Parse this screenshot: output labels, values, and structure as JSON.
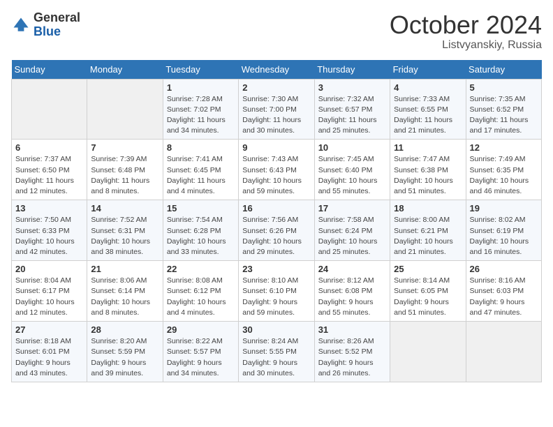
{
  "header": {
    "logo_general": "General",
    "logo_blue": "Blue",
    "month_title": "October 2024",
    "location": "Listvyanskiy, Russia"
  },
  "days_of_week": [
    "Sunday",
    "Monday",
    "Tuesday",
    "Wednesday",
    "Thursday",
    "Friday",
    "Saturday"
  ],
  "weeks": [
    [
      {
        "day": "",
        "empty": true
      },
      {
        "day": "",
        "empty": true
      },
      {
        "day": "1",
        "sunrise": "Sunrise: 7:28 AM",
        "sunset": "Sunset: 7:02 PM",
        "daylight": "Daylight: 11 hours and 34 minutes."
      },
      {
        "day": "2",
        "sunrise": "Sunrise: 7:30 AM",
        "sunset": "Sunset: 7:00 PM",
        "daylight": "Daylight: 11 hours and 30 minutes."
      },
      {
        "day": "3",
        "sunrise": "Sunrise: 7:32 AM",
        "sunset": "Sunset: 6:57 PM",
        "daylight": "Daylight: 11 hours and 25 minutes."
      },
      {
        "day": "4",
        "sunrise": "Sunrise: 7:33 AM",
        "sunset": "Sunset: 6:55 PM",
        "daylight": "Daylight: 11 hours and 21 minutes."
      },
      {
        "day": "5",
        "sunrise": "Sunrise: 7:35 AM",
        "sunset": "Sunset: 6:52 PM",
        "daylight": "Daylight: 11 hours and 17 minutes."
      }
    ],
    [
      {
        "day": "6",
        "sunrise": "Sunrise: 7:37 AM",
        "sunset": "Sunset: 6:50 PM",
        "daylight": "Daylight: 11 hours and 12 minutes."
      },
      {
        "day": "7",
        "sunrise": "Sunrise: 7:39 AM",
        "sunset": "Sunset: 6:48 PM",
        "daylight": "Daylight: 11 hours and 8 minutes."
      },
      {
        "day": "8",
        "sunrise": "Sunrise: 7:41 AM",
        "sunset": "Sunset: 6:45 PM",
        "daylight": "Daylight: 11 hours and 4 minutes."
      },
      {
        "day": "9",
        "sunrise": "Sunrise: 7:43 AM",
        "sunset": "Sunset: 6:43 PM",
        "daylight": "Daylight: 10 hours and 59 minutes."
      },
      {
        "day": "10",
        "sunrise": "Sunrise: 7:45 AM",
        "sunset": "Sunset: 6:40 PM",
        "daylight": "Daylight: 10 hours and 55 minutes."
      },
      {
        "day": "11",
        "sunrise": "Sunrise: 7:47 AM",
        "sunset": "Sunset: 6:38 PM",
        "daylight": "Daylight: 10 hours and 51 minutes."
      },
      {
        "day": "12",
        "sunrise": "Sunrise: 7:49 AM",
        "sunset": "Sunset: 6:35 PM",
        "daylight": "Daylight: 10 hours and 46 minutes."
      }
    ],
    [
      {
        "day": "13",
        "sunrise": "Sunrise: 7:50 AM",
        "sunset": "Sunset: 6:33 PM",
        "daylight": "Daylight: 10 hours and 42 minutes."
      },
      {
        "day": "14",
        "sunrise": "Sunrise: 7:52 AM",
        "sunset": "Sunset: 6:31 PM",
        "daylight": "Daylight: 10 hours and 38 minutes."
      },
      {
        "day": "15",
        "sunrise": "Sunrise: 7:54 AM",
        "sunset": "Sunset: 6:28 PM",
        "daylight": "Daylight: 10 hours and 33 minutes."
      },
      {
        "day": "16",
        "sunrise": "Sunrise: 7:56 AM",
        "sunset": "Sunset: 6:26 PM",
        "daylight": "Daylight: 10 hours and 29 minutes."
      },
      {
        "day": "17",
        "sunrise": "Sunrise: 7:58 AM",
        "sunset": "Sunset: 6:24 PM",
        "daylight": "Daylight: 10 hours and 25 minutes."
      },
      {
        "day": "18",
        "sunrise": "Sunrise: 8:00 AM",
        "sunset": "Sunset: 6:21 PM",
        "daylight": "Daylight: 10 hours and 21 minutes."
      },
      {
        "day": "19",
        "sunrise": "Sunrise: 8:02 AM",
        "sunset": "Sunset: 6:19 PM",
        "daylight": "Daylight: 10 hours and 16 minutes."
      }
    ],
    [
      {
        "day": "20",
        "sunrise": "Sunrise: 8:04 AM",
        "sunset": "Sunset: 6:17 PM",
        "daylight": "Daylight: 10 hours and 12 minutes."
      },
      {
        "day": "21",
        "sunrise": "Sunrise: 8:06 AM",
        "sunset": "Sunset: 6:14 PM",
        "daylight": "Daylight: 10 hours and 8 minutes."
      },
      {
        "day": "22",
        "sunrise": "Sunrise: 8:08 AM",
        "sunset": "Sunset: 6:12 PM",
        "daylight": "Daylight: 10 hours and 4 minutes."
      },
      {
        "day": "23",
        "sunrise": "Sunrise: 8:10 AM",
        "sunset": "Sunset: 6:10 PM",
        "daylight": "Daylight: 9 hours and 59 minutes."
      },
      {
        "day": "24",
        "sunrise": "Sunrise: 8:12 AM",
        "sunset": "Sunset: 6:08 PM",
        "daylight": "Daylight: 9 hours and 55 minutes."
      },
      {
        "day": "25",
        "sunrise": "Sunrise: 8:14 AM",
        "sunset": "Sunset: 6:05 PM",
        "daylight": "Daylight: 9 hours and 51 minutes."
      },
      {
        "day": "26",
        "sunrise": "Sunrise: 8:16 AM",
        "sunset": "Sunset: 6:03 PM",
        "daylight": "Daylight: 9 hours and 47 minutes."
      }
    ],
    [
      {
        "day": "27",
        "sunrise": "Sunrise: 8:18 AM",
        "sunset": "Sunset: 6:01 PM",
        "daylight": "Daylight: 9 hours and 43 minutes."
      },
      {
        "day": "28",
        "sunrise": "Sunrise: 8:20 AM",
        "sunset": "Sunset: 5:59 PM",
        "daylight": "Daylight: 9 hours and 39 minutes."
      },
      {
        "day": "29",
        "sunrise": "Sunrise: 8:22 AM",
        "sunset": "Sunset: 5:57 PM",
        "daylight": "Daylight: 9 hours and 34 minutes."
      },
      {
        "day": "30",
        "sunrise": "Sunrise: 8:24 AM",
        "sunset": "Sunset: 5:55 PM",
        "daylight": "Daylight: 9 hours and 30 minutes."
      },
      {
        "day": "31",
        "sunrise": "Sunrise: 8:26 AM",
        "sunset": "Sunset: 5:52 PM",
        "daylight": "Daylight: 9 hours and 26 minutes."
      },
      {
        "day": "",
        "empty": true
      },
      {
        "day": "",
        "empty": true
      }
    ]
  ]
}
